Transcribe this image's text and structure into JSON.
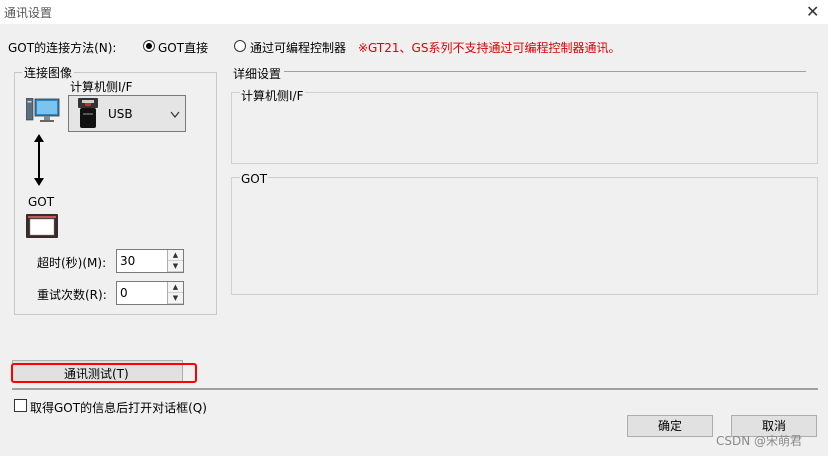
{
  "window": {
    "title": "通讯设置",
    "close_glyph": "✕"
  },
  "connection": {
    "method_label": "GOT的连接方法(N):",
    "option_direct": "GOT直接",
    "option_plc": "通过可编程控制器",
    "warning": "※GT21、GS系列不支持通过可编程控制器通讯。",
    "warning_color": "#e00000",
    "selected": "GOT直接"
  },
  "image_group": {
    "title": "连接图像",
    "pc_if_label": "计算机侧I/F",
    "usb_value": "USB",
    "got_label": "GOT",
    "timeout_label": "超时(秒)(M):",
    "timeout_value": "30",
    "retry_label": "重试次数(R):",
    "retry_value": "0"
  },
  "detail": {
    "title": "详细设置",
    "pc_if_section": "计算机侧I/F",
    "got_section": "GOT"
  },
  "test_button": "通讯测试(T)",
  "checkbox_label": "取得GOT的信息后打开对话框(Q)",
  "ok_button": "确定",
  "cancel_button": "取消",
  "watermark": "CSDN @宋萌君"
}
